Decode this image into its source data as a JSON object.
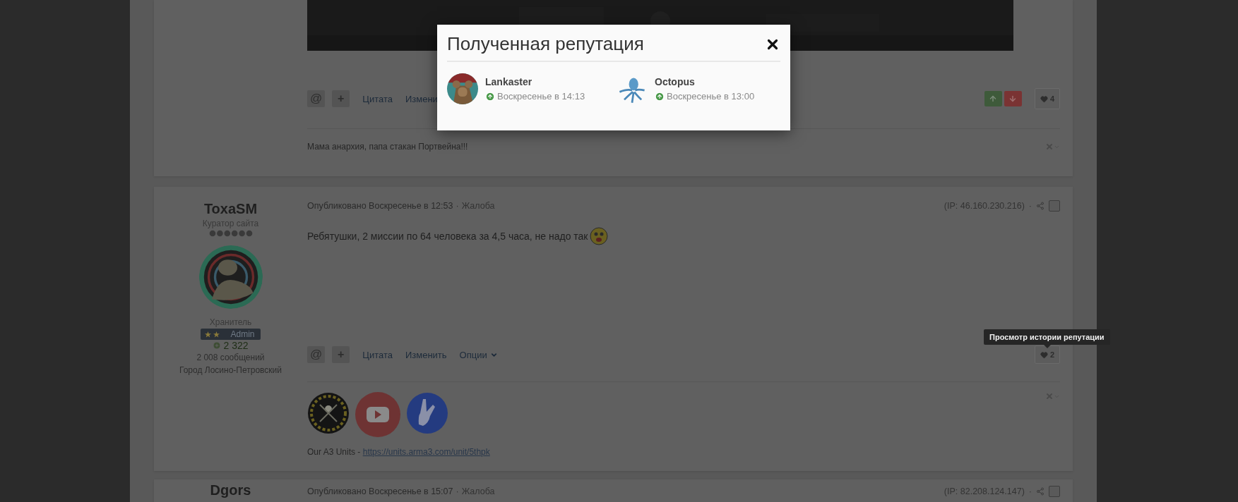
{
  "top_post": {
    "actions": [
      {
        "kind": "mention",
        "label": "@"
      },
      {
        "kind": "add",
        "label": "+"
      },
      {
        "kind": "link",
        "label": "Цитата"
      },
      {
        "kind": "link",
        "label": "Измени"
      }
    ],
    "reputation_count": "4",
    "signature": "Мама анархия, папа стакан Портвейна!!!"
  },
  "post": {
    "author": {
      "name": "ToxaSM",
      "title": "Куратор сайта",
      "group": "Хранитель",
      "badge": "Admin",
      "reputation": "2 322",
      "posts": "2 008 сообщений",
      "location": "Город Лосино-Петровский"
    },
    "published": "Опубликовано Воскресенье в 12:53",
    "separator": "·",
    "report": "Жалоба",
    "ip": "(IP: 46.160.230.216)",
    "ip_separator": "·",
    "selected": false,
    "body": "Ребятушки, 2 миссии по 64 человека за 4,5 часа, не надо так",
    "actions": [
      {
        "kind": "mention",
        "label": "@"
      },
      {
        "kind": "add",
        "label": "+"
      },
      {
        "kind": "link",
        "label": "Цитата"
      },
      {
        "kind": "link",
        "label": "Изменить"
      },
      {
        "kind": "menu",
        "label": "Опции"
      }
    ],
    "reputation_count": "2",
    "tooltip": "Просмотр истории репутации",
    "signature_prefix": "Our A3 Units -",
    "signature_link": "https://units.arma3.com/unit/5thpk"
  },
  "next_post": {
    "author": "Dgors",
    "published": "Опубликовано Воскресенье в 15:07",
    "separator": "·",
    "report": "Жалоба",
    "ip": "(IP: 82.208.124.147)",
    "ip_separator": "·",
    "selected": false
  },
  "modal": {
    "title": "Полученная репутация",
    "items": [
      {
        "name": "Lankaster",
        "time": "Воскресенье в 14:13"
      },
      {
        "name": "Octopus",
        "time": "Воскресенье в 13:00"
      }
    ]
  }
}
